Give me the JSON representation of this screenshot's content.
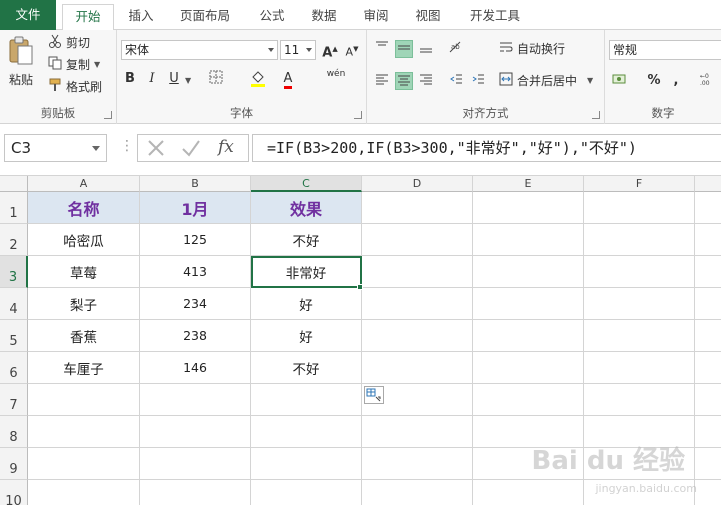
{
  "tabs": [
    "文件",
    "开始",
    "插入",
    "页面布局",
    "公式",
    "数据",
    "审阅",
    "视图",
    "开发工具"
  ],
  "clipboard": {
    "paste": "粘贴",
    "cut": "剪切",
    "copy": "复制",
    "format_painter": "格式刷",
    "label": "剪贴板"
  },
  "font": {
    "name": "宋体",
    "size": "11",
    "bold": "B",
    "italic": "I",
    "underline": "U",
    "grow": "A",
    "shrink": "A",
    "font_color": "A",
    "phonetic": "wén",
    "label": "字体"
  },
  "alignment": {
    "wrap_text": "自动换行",
    "merge_center": "合并后居中",
    "label": "对齐方式"
  },
  "number": {
    "format": "常规",
    "percent": "%",
    "comma": ",",
    "label": "数字"
  },
  "formula_bar": {
    "name_box": "C3",
    "formula": "=IF(B3>200,IF(B3>300,\"非常好\",\"好\"),\"不好\")",
    "fx": "fx"
  },
  "columns": [
    "A",
    "B",
    "C",
    "D",
    "E",
    "F"
  ],
  "rows": [
    "1",
    "2",
    "3",
    "4",
    "5",
    "6",
    "7",
    "8",
    "9",
    "10"
  ],
  "table": {
    "headers": [
      "名称",
      "1月",
      "效果"
    ],
    "rows": [
      [
        "哈密瓜",
        "125",
        "不好"
      ],
      [
        "草莓",
        "413",
        "非常好"
      ],
      [
        "梨子",
        "234",
        "好"
      ],
      [
        "香蕉",
        "238",
        "好"
      ],
      [
        "车厘子",
        "146",
        "不好"
      ]
    ]
  },
  "watermark": {
    "brand": "Bai du 经验",
    "url": "jingyan.baidu.com"
  },
  "colors": {
    "accent": "#217346",
    "header_fill": "#dce6f1",
    "header_text": "#7030a0"
  }
}
